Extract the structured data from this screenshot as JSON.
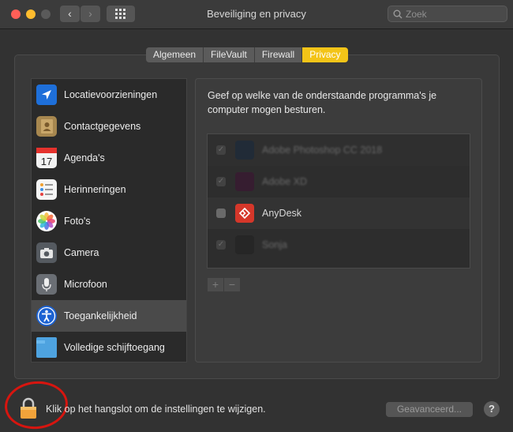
{
  "window": {
    "title": "Beveiliging en privacy"
  },
  "toolbar": {
    "back_label": "‹",
    "forward_label": "›"
  },
  "search": {
    "placeholder": "Zoek"
  },
  "tabs": [
    {
      "label": "Algemeen",
      "active": false
    },
    {
      "label": "FileVault",
      "active": false
    },
    {
      "label": "Firewall",
      "active": false
    },
    {
      "label": "Privacy",
      "active": true
    }
  ],
  "categories": [
    {
      "label": "Locatievoorzieningen",
      "icon": "location-arrow-icon"
    },
    {
      "label": "Contactgegevens",
      "icon": "contacts-book-icon"
    },
    {
      "label": "Agenda's",
      "icon": "calendar-icon",
      "icon_text": "17"
    },
    {
      "label": "Herinneringen",
      "icon": "reminders-list-icon"
    },
    {
      "label": "Foto's",
      "icon": "photos-flower-icon"
    },
    {
      "label": "Camera",
      "icon": "camera-icon"
    },
    {
      "label": "Microfoon",
      "icon": "microphone-icon"
    },
    {
      "label": "Toegankelijkheid",
      "icon": "accessibility-icon",
      "selected": true
    },
    {
      "label": "Volledige schijftoegang",
      "icon": "folder-icon"
    }
  ],
  "main": {
    "description": "Geef op welke van de onderstaande programma's je computer mogen besturen.",
    "apps": [
      {
        "name": "Adobe Photoshop CC 2018",
        "checked": true,
        "icon": "photoshop-icon",
        "obscured": true
      },
      {
        "name": "Adobe XD",
        "checked": true,
        "icon": "adobe-xd-icon",
        "obscured": true
      },
      {
        "name": "AnyDesk",
        "checked": false,
        "icon": "anydesk-icon",
        "obscured": false
      },
      {
        "name": "Sonja",
        "checked": true,
        "icon": "app-icon",
        "obscured": true
      }
    ],
    "add_label": "+",
    "remove_label": "−"
  },
  "footer": {
    "lock_text": "Klik op het hangslot om de instellingen te wijzigen.",
    "advanced_label": "Geavanceerd...",
    "help_label": "?"
  },
  "colors": {
    "accent": "#f3c418",
    "annotation_ring": "#d7150f"
  }
}
